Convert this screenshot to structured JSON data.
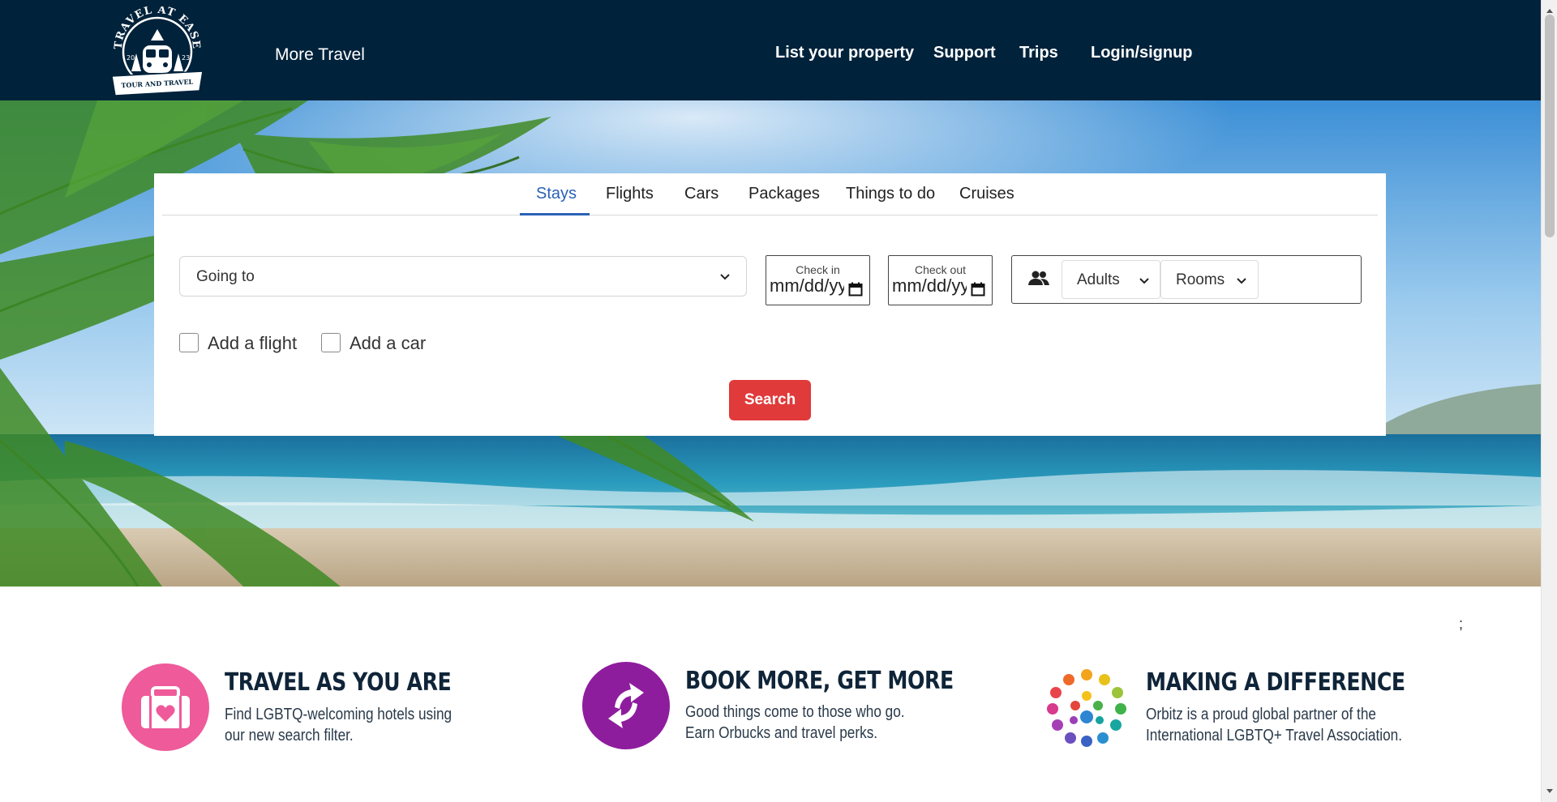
{
  "header": {
    "logo": {
      "arc_text": "TRAVEL AT EASE",
      "year_left": "20",
      "year_right": "23",
      "banner_text": "TOUR AND TRAVEL"
    },
    "more_travel": "More Travel",
    "nav": {
      "list_property": "List your property",
      "support": "Support",
      "trips": "Trips",
      "login": "Login/signup"
    }
  },
  "search": {
    "tabs": [
      "Stays",
      "Flights",
      "Cars",
      "Packages",
      "Things to do",
      "Cruises"
    ],
    "active_tab": "Stays",
    "going_to": "Going to",
    "check_in": {
      "label": "Check in",
      "value": "mm/dd/yyyy"
    },
    "check_out": {
      "label": "Check out",
      "value": "mm/dd/yyyy"
    },
    "adults": "Adults",
    "rooms": "Rooms",
    "add_flight": "Add a flight",
    "add_car": "Add a car",
    "button": "Search"
  },
  "stray_text": ";",
  "promos": [
    {
      "icon": "suitcase-heart-icon",
      "title": "TRAVEL AS YOU ARE",
      "line1": "Find LGBTQ-welcoming hotels using",
      "line2": "our new search filter."
    },
    {
      "icon": "exchange-arrows-icon",
      "title": "BOOK MORE, GET MORE",
      "line1": "Good things come to those who go.",
      "line2": "Earn Orbucks and travel perks."
    },
    {
      "icon": "colorful-globe-icon",
      "title": "MAKING A DIFFERENCE",
      "line1": "Orbitz is a proud global partner of the",
      "line2": "International LGBTQ+ Travel Association."
    }
  ],
  "colors": {
    "header_bg": "#01223b",
    "active_tab": "#2a62b6",
    "search_button": "#e03a3a",
    "promo_pink": "#ee5a9a",
    "promo_purple": "#8e1d9e"
  }
}
